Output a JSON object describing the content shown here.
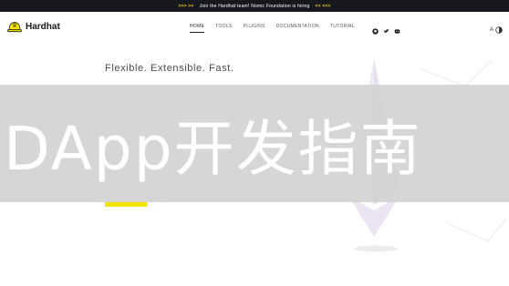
{
  "announcement": {
    "left_arrows": ">>> >>",
    "message": "Join the Hardhat team! Nomic Foundation is hiring",
    "right_arrows": "<< <<<"
  },
  "header": {
    "logo_text": "Hardhat",
    "nav": [
      {
        "label": "HOME"
      },
      {
        "label": "TOOLS"
      },
      {
        "label": "PLUGINS"
      },
      {
        "label": "DOCUMENTATION"
      },
      {
        "label": "TUTORIAL"
      }
    ],
    "lang_label": "A"
  },
  "hero": {
    "tagline": "Flexible. Extensible. Fast."
  },
  "overlay": {
    "title": "DApp开发指南"
  },
  "colors": {
    "accent_yellow": "#f1e400",
    "dark": "#16181d",
    "overlay": "#d2d2d2"
  }
}
